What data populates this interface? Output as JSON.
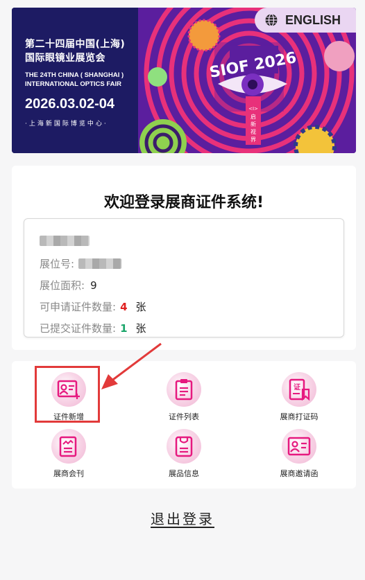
{
  "banner": {
    "title_line1": "第二十四届中国(上海)",
    "title_line2": "国际眼镜业展览会",
    "en_line1": "THE 24TH CHINA ( SHANGHAI )",
    "en_line2": "INTERNATIONAL OPTICS FAIR",
    "date": "2026.03.02-04",
    "venue": "·上海新国际博览中心·",
    "logo_text": "SIOF 2026",
    "tagline": "<I>启新视界",
    "colors": {
      "navy": "#1d1b63",
      "purple": "#5b1e9e",
      "pink": "#e8317a"
    }
  },
  "language_button": {
    "label": "ENGLISH",
    "icon": "globe-icon"
  },
  "login_card": {
    "title": "欢迎登录展商证件系统!",
    "booth_no_label": "展位号:",
    "booth_area_label": "展位面积:",
    "booth_area_value": "9",
    "available_label": "可申请证件数量:",
    "available_value": "4",
    "available_unit": "张",
    "submitted_label": "已提交证件数量:",
    "submitted_value": "1",
    "submitted_unit": "张"
  },
  "menu": [
    {
      "label": "证件新增",
      "icon": "add-certificate-icon"
    },
    {
      "label": "证件列表",
      "icon": "clipboard-list-icon"
    },
    {
      "label": "展商打证码",
      "icon": "certificate-icon"
    },
    {
      "label": "展商会刊",
      "icon": "catalogue-icon"
    },
    {
      "label": "展品信息",
      "icon": "product-tag-icon"
    },
    {
      "label": "展商邀请函",
      "icon": "invitation-card-icon"
    }
  ],
  "logout_label": "退出登录",
  "accent_color": "#e6197f",
  "highlight_color": "#e23a3a"
}
